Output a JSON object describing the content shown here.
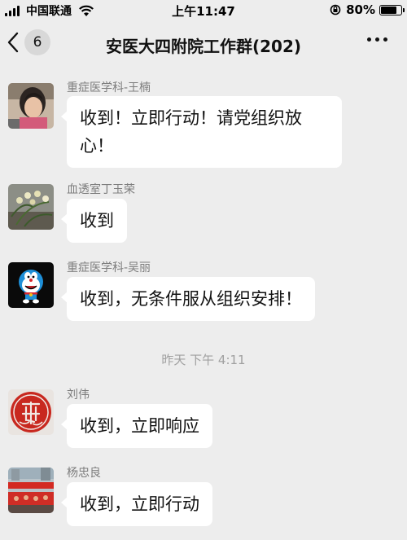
{
  "status_bar": {
    "carrier": "中国联通",
    "time": "上午11:47",
    "battery": "80%",
    "battery_level": 0.8
  },
  "nav": {
    "back_count": "6",
    "title": "安医大四附院工作群(202)"
  },
  "messages": [
    {
      "sender": "重症医学科-王楠",
      "text": "收到！立即行动！请党组织放心！",
      "line1": "收到！立即行动！请党组织放",
      "line2": "心！",
      "avatar": "girl-photo"
    },
    {
      "sender": "血透室丁玉荣",
      "text": "收到",
      "avatar": "orchid-photo"
    },
    {
      "sender": "重症医学科-吴丽",
      "text": "收到，无条件服从组织安排！",
      "avatar": "doraemon-image"
    }
  ],
  "timestamp": "昨天 下午 4:11",
  "messages2": [
    {
      "sender": "刘伟",
      "text": "收到，立即响应",
      "avatar": "red-calligraphy-seal"
    },
    {
      "sender": "杨忠良",
      "text": "收到，立即行动",
      "avatar": "red-banner-photo"
    }
  ]
}
